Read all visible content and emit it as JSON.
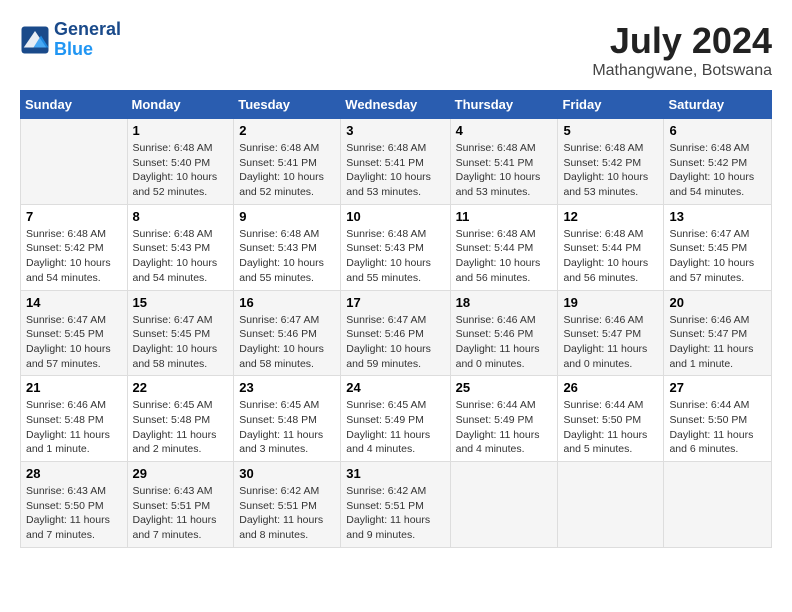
{
  "header": {
    "logo_line1": "General",
    "logo_line2": "Blue",
    "month": "July 2024",
    "location": "Mathangwane, Botswana"
  },
  "weekdays": [
    "Sunday",
    "Monday",
    "Tuesday",
    "Wednesday",
    "Thursday",
    "Friday",
    "Saturday"
  ],
  "weeks": [
    [
      {
        "day": "",
        "info": ""
      },
      {
        "day": "1",
        "info": "Sunrise: 6:48 AM\nSunset: 5:40 PM\nDaylight: 10 hours\nand 52 minutes."
      },
      {
        "day": "2",
        "info": "Sunrise: 6:48 AM\nSunset: 5:41 PM\nDaylight: 10 hours\nand 52 minutes."
      },
      {
        "day": "3",
        "info": "Sunrise: 6:48 AM\nSunset: 5:41 PM\nDaylight: 10 hours\nand 53 minutes."
      },
      {
        "day": "4",
        "info": "Sunrise: 6:48 AM\nSunset: 5:41 PM\nDaylight: 10 hours\nand 53 minutes."
      },
      {
        "day": "5",
        "info": "Sunrise: 6:48 AM\nSunset: 5:42 PM\nDaylight: 10 hours\nand 53 minutes."
      },
      {
        "day": "6",
        "info": "Sunrise: 6:48 AM\nSunset: 5:42 PM\nDaylight: 10 hours\nand 54 minutes."
      }
    ],
    [
      {
        "day": "7",
        "info": "Sunrise: 6:48 AM\nSunset: 5:42 PM\nDaylight: 10 hours\nand 54 minutes."
      },
      {
        "day": "8",
        "info": "Sunrise: 6:48 AM\nSunset: 5:43 PM\nDaylight: 10 hours\nand 54 minutes."
      },
      {
        "day": "9",
        "info": "Sunrise: 6:48 AM\nSunset: 5:43 PM\nDaylight: 10 hours\nand 55 minutes."
      },
      {
        "day": "10",
        "info": "Sunrise: 6:48 AM\nSunset: 5:43 PM\nDaylight: 10 hours\nand 55 minutes."
      },
      {
        "day": "11",
        "info": "Sunrise: 6:48 AM\nSunset: 5:44 PM\nDaylight: 10 hours\nand 56 minutes."
      },
      {
        "day": "12",
        "info": "Sunrise: 6:48 AM\nSunset: 5:44 PM\nDaylight: 10 hours\nand 56 minutes."
      },
      {
        "day": "13",
        "info": "Sunrise: 6:47 AM\nSunset: 5:45 PM\nDaylight: 10 hours\nand 57 minutes."
      }
    ],
    [
      {
        "day": "14",
        "info": "Sunrise: 6:47 AM\nSunset: 5:45 PM\nDaylight: 10 hours\nand 57 minutes."
      },
      {
        "day": "15",
        "info": "Sunrise: 6:47 AM\nSunset: 5:45 PM\nDaylight: 10 hours\nand 58 minutes."
      },
      {
        "day": "16",
        "info": "Sunrise: 6:47 AM\nSunset: 5:46 PM\nDaylight: 10 hours\nand 58 minutes."
      },
      {
        "day": "17",
        "info": "Sunrise: 6:47 AM\nSunset: 5:46 PM\nDaylight: 10 hours\nand 59 minutes."
      },
      {
        "day": "18",
        "info": "Sunrise: 6:46 AM\nSunset: 5:46 PM\nDaylight: 11 hours\nand 0 minutes."
      },
      {
        "day": "19",
        "info": "Sunrise: 6:46 AM\nSunset: 5:47 PM\nDaylight: 11 hours\nand 0 minutes."
      },
      {
        "day": "20",
        "info": "Sunrise: 6:46 AM\nSunset: 5:47 PM\nDaylight: 11 hours\nand 1 minute."
      }
    ],
    [
      {
        "day": "21",
        "info": "Sunrise: 6:46 AM\nSunset: 5:48 PM\nDaylight: 11 hours\nand 1 minute."
      },
      {
        "day": "22",
        "info": "Sunrise: 6:45 AM\nSunset: 5:48 PM\nDaylight: 11 hours\nand 2 minutes."
      },
      {
        "day": "23",
        "info": "Sunrise: 6:45 AM\nSunset: 5:48 PM\nDaylight: 11 hours\nand 3 minutes."
      },
      {
        "day": "24",
        "info": "Sunrise: 6:45 AM\nSunset: 5:49 PM\nDaylight: 11 hours\nand 4 minutes."
      },
      {
        "day": "25",
        "info": "Sunrise: 6:44 AM\nSunset: 5:49 PM\nDaylight: 11 hours\nand 4 minutes."
      },
      {
        "day": "26",
        "info": "Sunrise: 6:44 AM\nSunset: 5:50 PM\nDaylight: 11 hours\nand 5 minutes."
      },
      {
        "day": "27",
        "info": "Sunrise: 6:44 AM\nSunset: 5:50 PM\nDaylight: 11 hours\nand 6 minutes."
      }
    ],
    [
      {
        "day": "28",
        "info": "Sunrise: 6:43 AM\nSunset: 5:50 PM\nDaylight: 11 hours\nand 7 minutes."
      },
      {
        "day": "29",
        "info": "Sunrise: 6:43 AM\nSunset: 5:51 PM\nDaylight: 11 hours\nand 7 minutes."
      },
      {
        "day": "30",
        "info": "Sunrise: 6:42 AM\nSunset: 5:51 PM\nDaylight: 11 hours\nand 8 minutes."
      },
      {
        "day": "31",
        "info": "Sunrise: 6:42 AM\nSunset: 5:51 PM\nDaylight: 11 hours\nand 9 minutes."
      },
      {
        "day": "",
        "info": ""
      },
      {
        "day": "",
        "info": ""
      },
      {
        "day": "",
        "info": ""
      }
    ]
  ]
}
